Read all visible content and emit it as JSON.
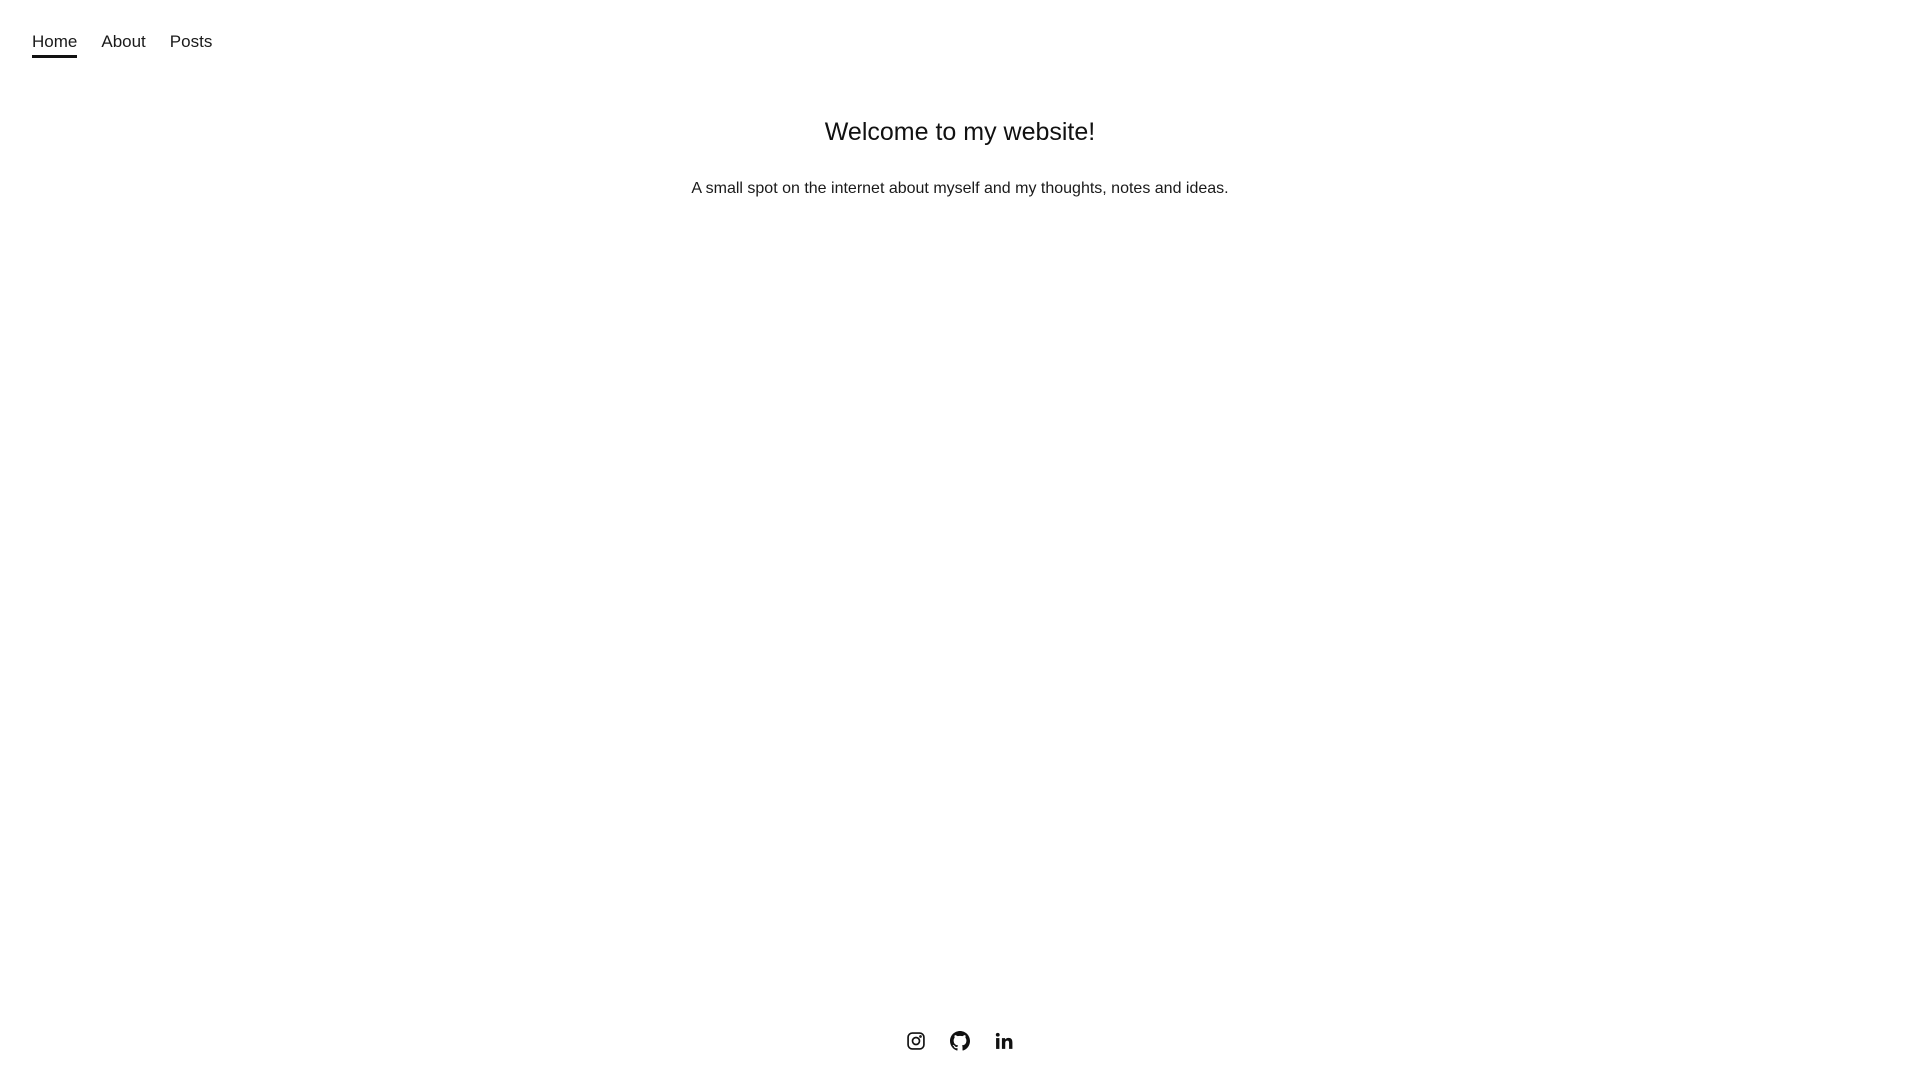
{
  "nav": {
    "items": [
      {
        "label": "Home",
        "active": true
      },
      {
        "label": "About",
        "active": false
      },
      {
        "label": "Posts",
        "active": false
      }
    ]
  },
  "hero": {
    "title": "Welcome to my website!",
    "subtitle": "A small spot on the internet about myself and my thoughts, notes and ideas."
  },
  "footer": {
    "social": [
      {
        "icon": "instagram-icon"
      },
      {
        "icon": "github-icon"
      },
      {
        "icon": "linkedin-icon"
      }
    ]
  },
  "colors": {
    "text": "#1a1a1a",
    "background": "#ffffff",
    "underline": "#111111"
  }
}
